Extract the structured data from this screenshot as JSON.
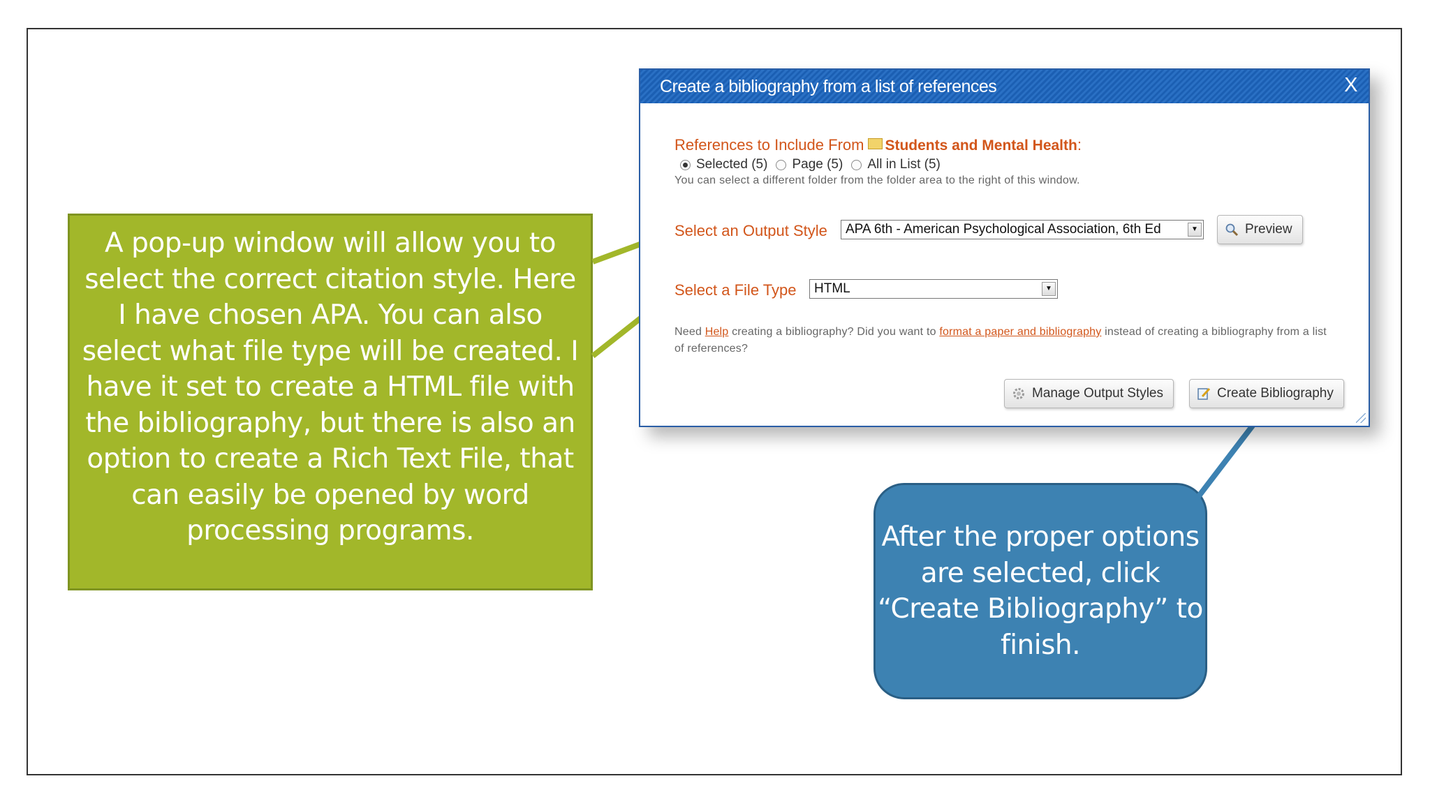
{
  "dialog": {
    "title": "Create a bibliography from a list of references",
    "close": "X",
    "references_label": "References to Include From",
    "folder_name": "Students and Mental Health",
    "folder_suffix": ":",
    "radios": [
      {
        "label": "Selected (5)",
        "checked": true
      },
      {
        "label": "Page (5)",
        "checked": false
      },
      {
        "label": "All in List (5)",
        "checked": false
      }
    ],
    "hint": "You can select a different folder from the folder area to the right of this window.",
    "output_style_label": "Select an Output Style",
    "output_style_value": "APA 6th - American Psychological Association, 6th Ed",
    "preview_button": "Preview",
    "file_type_label": "Select a File Type",
    "file_type_value": "HTML",
    "help": {
      "prefix": "Need ",
      "help_link": "Help",
      "middle": " creating a bibliography? Did you want to ",
      "format_link": "format a paper and bibliography",
      "suffix": " instead of creating a bibliography from a list of references?"
    },
    "manage_button": "Manage Output Styles",
    "create_button": "Create Bibliography"
  },
  "callouts": {
    "green": "A pop-up window will allow you to select the correct citation style. Here I have chosen APA. You can also select what file type will be created. I have it set to create a HTML file with the bibliography, but there is also an option to create a Rich Text File, that can easily be opened by word processing programs.",
    "blue": "After the proper options are selected, click “Create Bibliography” to finish."
  },
  "colors": {
    "green_callout": "#a2b72a",
    "blue_callout": "#3d82b2",
    "dialog_title_bar": "#1b5fb3",
    "label_orange": "#d2561b"
  }
}
